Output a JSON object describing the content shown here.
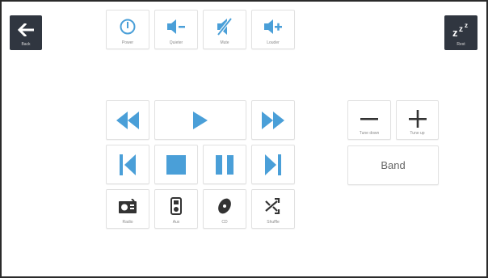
{
  "header": {
    "back_label": "Back",
    "rest_label": "Rest",
    "power_label": "Power",
    "quieter_label": "Quieter",
    "mute_label": "Mute",
    "louder_label": "Louder"
  },
  "tuner": {
    "tune_down_label": "Tune down",
    "tune_up_label": "Tune up",
    "band_label": "Band"
  },
  "sources": {
    "radio_label": "Radio",
    "aux_label": "Aux",
    "cd_label": "CD",
    "shuffle_label": "Shuffle"
  },
  "colors": {
    "accent": "#4a9fd8",
    "dark_button": "#303640",
    "icon_dark": "#333333"
  },
  "icons": {
    "back": "arrow-left-icon",
    "rest": "zzz-icon",
    "power": "power-icon",
    "quieter": "volume-down-icon",
    "mute": "mute-icon",
    "louder": "volume-up-icon",
    "rewind": "rewind-icon",
    "play": "play-icon",
    "fast_forward": "fast-forward-icon",
    "skip_previous": "skip-previous-icon",
    "stop": "stop-icon",
    "pause": "pause-icon",
    "skip_next": "skip-next-icon",
    "tune_down": "minus-icon",
    "tune_up": "plus-icon",
    "radio": "radio-icon",
    "aux": "mp3-player-icon",
    "cd": "disc-icon",
    "shuffle": "shuffle-icon"
  }
}
